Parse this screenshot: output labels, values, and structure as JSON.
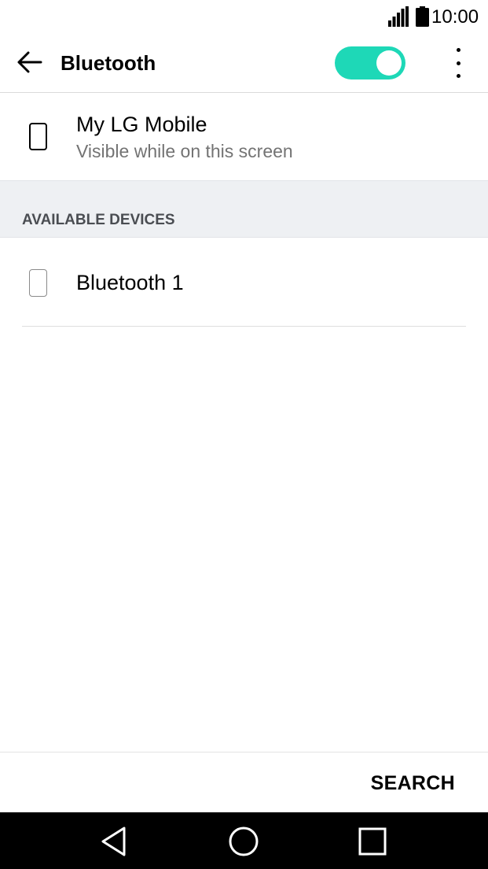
{
  "status_bar": {
    "time": "10:00",
    "signal_icon": "signal-icon",
    "battery_icon": "battery-icon"
  },
  "app_bar": {
    "back_icon": "arrow-left-icon",
    "title": "Bluetooth",
    "toggle_on": true,
    "toggle_color": "#1ed8b7",
    "menu_icon": "more-vert-icon"
  },
  "my_device": {
    "icon": "phone-icon",
    "name": "My LG Mobile",
    "subtitle": "Visible while on this screen"
  },
  "available_devices": {
    "header": "AVAILABLE DEVICES",
    "items": [
      {
        "icon": "phone-icon",
        "name": "Bluetooth 1"
      }
    ]
  },
  "actions": {
    "search_label": "SEARCH"
  },
  "nav_bar": {
    "back_icon": "triangle-back-icon",
    "home_icon": "circle-home-icon",
    "recents_icon": "square-recents-icon"
  }
}
